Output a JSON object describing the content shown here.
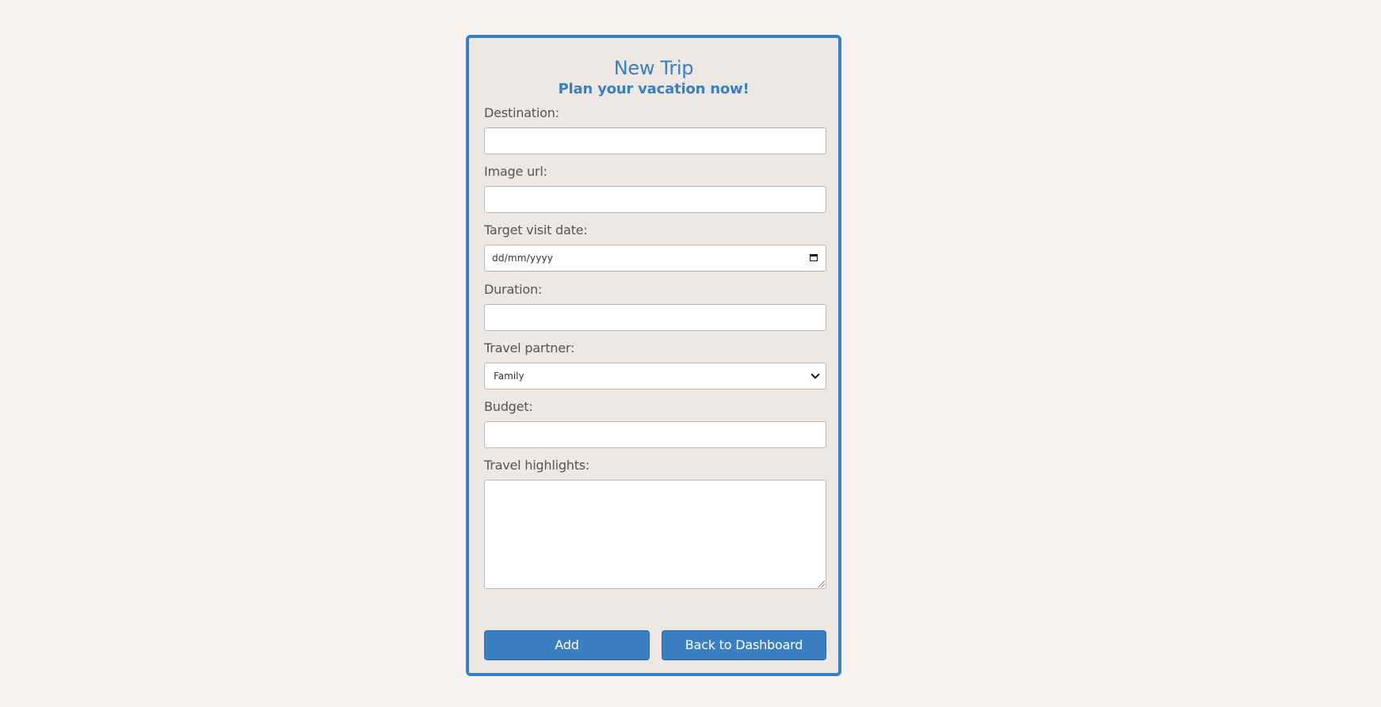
{
  "form": {
    "title": "New Trip",
    "subtitle": "Plan your vacation now!",
    "fields": {
      "destination": {
        "label": "Destination:",
        "value": ""
      },
      "image_url": {
        "label": "Image url:",
        "value": ""
      },
      "target_date": {
        "label": "Target visit date:",
        "placeholder": "dd/mm/yyyy"
      },
      "duration": {
        "label": "Duration:",
        "value": ""
      },
      "travel_partner": {
        "label": "Travel partner:",
        "selected": "Family"
      },
      "budget": {
        "label": "Budget:",
        "value": ""
      },
      "highlights": {
        "label": "Travel highlights:",
        "value": ""
      }
    },
    "buttons": {
      "add": "Add",
      "back": "Back to Dashboard"
    }
  },
  "colors": {
    "accent": "#3a7fc1",
    "card_background": "#ede8e3",
    "page_background": "#f6f2ef",
    "label_text": "#555555"
  },
  "icons": {
    "date_picker": "calendar-icon",
    "select": "chevron-down-icon",
    "textarea": "resize-grip-icon"
  }
}
